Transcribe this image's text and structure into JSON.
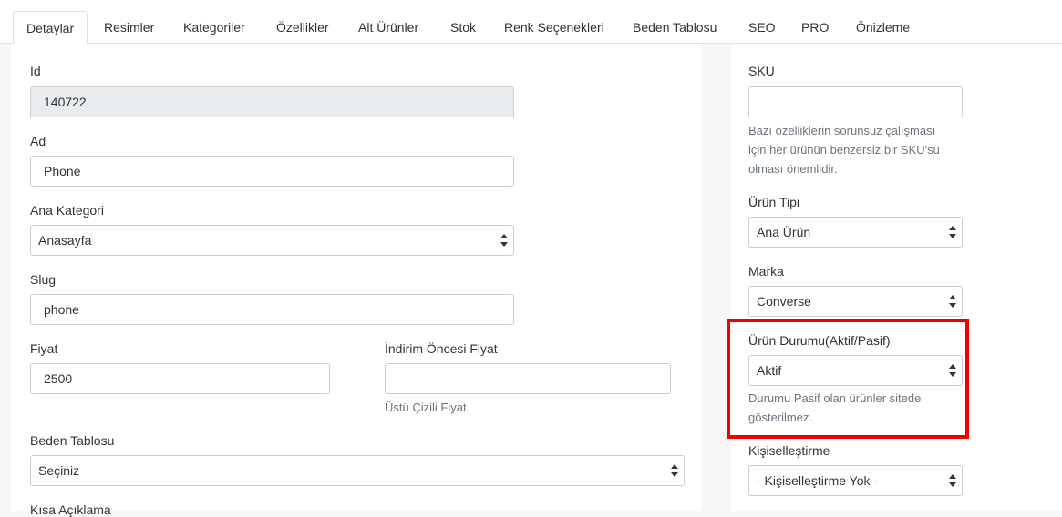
{
  "tabs": [
    "Detaylar",
    "Resimler",
    "Kategoriler",
    "Özellikler",
    "Alt Ürünler",
    "Stok",
    "Renk Seçenekleri",
    "Beden Tablosu",
    "SEO",
    "PRO",
    "Önizleme"
  ],
  "left": {
    "id_label": "Id",
    "id_value": "140722",
    "ad_label": "Ad",
    "ad_value": "Phone",
    "ana_kategori_label": "Ana Kategori",
    "ana_kategori_value": "Anasayfa",
    "slug_label": "Slug",
    "slug_value": "phone",
    "fiyat_label": "Fiyat",
    "fiyat_value": "2500",
    "indirim_label": "İndirim Öncesi Fiyat",
    "indirim_value": "",
    "indirim_help": "Üstü Çizili Fiyat.",
    "beden_label": "Beden Tablosu",
    "beden_value": "Seçiniz",
    "kisa_label": "Kısa Açıklama"
  },
  "right": {
    "sku_label": "SKU",
    "sku_value": "",
    "sku_help_1": "Bazı özelliklerin sorunsuz çalışması",
    "sku_help_2": "için her ürünün benzersiz bir SKU'su",
    "sku_help_3": "olması önemlidir.",
    "tip_label": "Ürün Tipi",
    "tip_value": "Ana Ürün",
    "marka_label": "Marka",
    "marka_value": "Converse",
    "durum_label": "Ürün Durumu(Aktif/Pasif)",
    "durum_value": "Aktif",
    "durum_help_1": "Durumu Pasif olan ürünler sitede",
    "durum_help_2": "gösterilmez.",
    "kisisel_label": "Kişiselleştirme",
    "kisisel_value": "- Kişiselleştirme Yok -"
  },
  "colors": {
    "highlight": "#f00000"
  }
}
